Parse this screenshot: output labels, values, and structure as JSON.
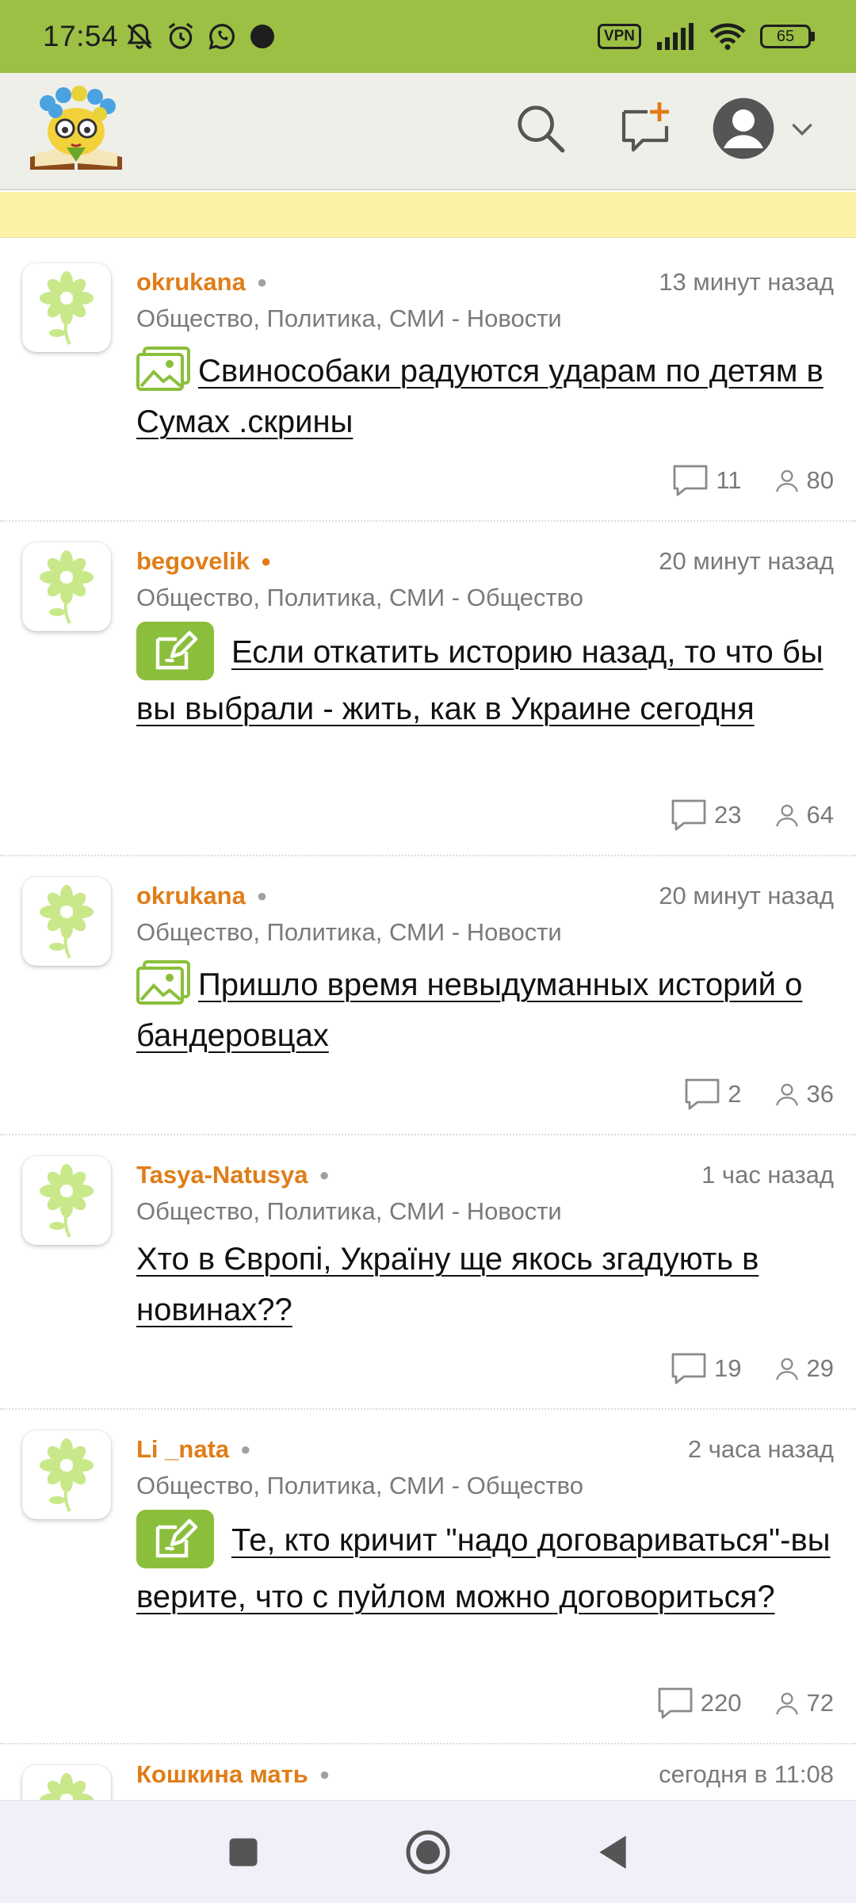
{
  "status_bar": {
    "time": "17:54",
    "vpn": "VPN",
    "battery": "65",
    "icons": [
      "dnd-off-icon",
      "alarm-icon",
      "whatsapp-icon",
      "dot-icon",
      "signal-icon",
      "wifi-icon"
    ]
  },
  "header": {
    "icons": [
      "site-logo",
      "search-icon",
      "new-post-icon",
      "account-icon",
      "chevron-down-icon"
    ]
  },
  "colors": {
    "status_bar": "#9bc044",
    "author": "#e07d17",
    "poll_badge": "#8bbf3b",
    "notice_strip": "#fcf2a6"
  },
  "posts": [
    {
      "author": "okrukana",
      "time": "13 минут назад",
      "category": "Общество, Политика, СМИ - Новости",
      "type_icon": "image-icon",
      "title": "Свинособаки радуются ударам по детям в Сумах .скрины",
      "comments": "11",
      "views": "80"
    },
    {
      "author": "begovelik",
      "time": "20 минут назад",
      "category": "Общество, Политика, СМИ - Общество",
      "type_icon": "poll-icon",
      "title": "Если откатить историю назад, то что бы вы выбрали - жить, как в Украине сегодня",
      "comments": "23",
      "views": "64"
    },
    {
      "author": "okrukana",
      "time": "20 минут назад",
      "category": "Общество, Политика, СМИ - Новости",
      "type_icon": "image-icon",
      "title": "Пришло время невыдуманных историй о бандеровцах",
      "comments": "2",
      "views": "36"
    },
    {
      "author": "Tasya-Natusya",
      "time": "1 час назад",
      "category": "Общество, Политика, СМИ - Новости",
      "type_icon": "",
      "title": "Хто в Європі, Україну ще якось згадують в новинах??",
      "comments": "19",
      "views": "29"
    },
    {
      "author": "Li _nata",
      "time": "2 часа назад",
      "category": "Общество, Политика, СМИ - Общество",
      "type_icon": "poll-icon",
      "title": "Те, кто кричит \"надо договариваться\"-вы верите, что с пуйлом можно договориться?",
      "comments": "220",
      "views": "72"
    },
    {
      "author": "Кошкина мать",
      "time": "сегодня в 11:08"
    }
  ],
  "nav": {
    "icons": [
      "recents-icon",
      "home-icon",
      "back-icon"
    ]
  }
}
